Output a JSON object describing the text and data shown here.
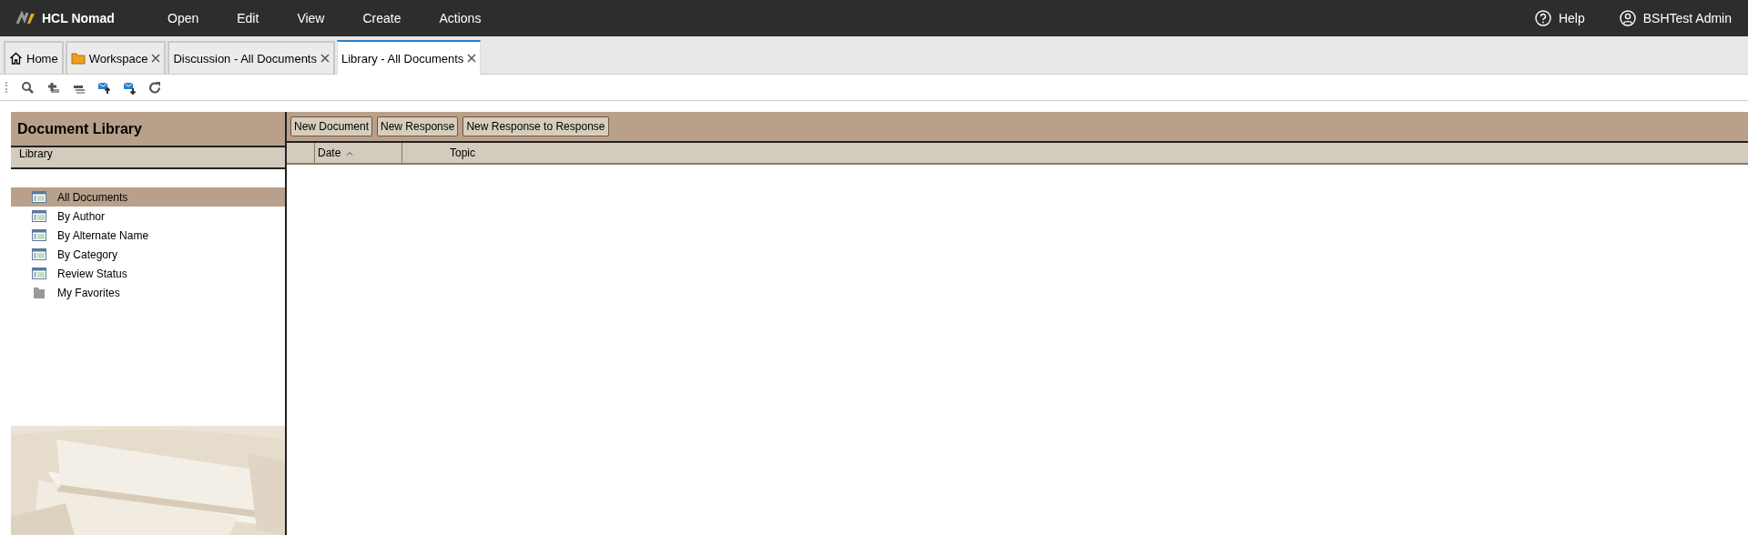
{
  "app": {
    "name": "HCL Nomad"
  },
  "menu": [
    "Open",
    "Edit",
    "View",
    "Create",
    "Actions"
  ],
  "header_links": [
    {
      "kind": "help",
      "label": "Help"
    },
    {
      "kind": "user",
      "label": "BSHTest Admin"
    }
  ],
  "tabs": [
    {
      "label": "Home",
      "kind": "home",
      "closable": false,
      "selected": false
    },
    {
      "label": "Workspace",
      "kind": "folder",
      "closable": true,
      "selected": false
    },
    {
      "label": "Discussion - All Documents",
      "kind": "plain",
      "closable": true,
      "selected": false
    },
    {
      "label": "Library - All Documents",
      "kind": "plain",
      "closable": true,
      "selected": true
    }
  ],
  "toolbar": [
    {
      "kind": "search"
    },
    {
      "kind": "add"
    },
    {
      "kind": "remove"
    },
    {
      "kind": "mail-up"
    },
    {
      "kind": "mail-down"
    },
    {
      "kind": "refresh"
    }
  ],
  "sidebar": {
    "title": "Document Library",
    "section": "Library",
    "items": [
      {
        "label": "All Documents",
        "kind": "view",
        "selected": true
      },
      {
        "label": "By Author",
        "kind": "view",
        "selected": false
      },
      {
        "label": "By Alternate Name",
        "kind": "view",
        "selected": false
      },
      {
        "label": "By Category",
        "kind": "view",
        "selected": false
      },
      {
        "label": "Review Status",
        "kind": "view",
        "selected": false
      },
      {
        "label": "My Favorites",
        "kind": "folder",
        "selected": false
      }
    ]
  },
  "actions": [
    "New Document",
    "New Response",
    "New Response to Response"
  ],
  "table": {
    "columns": [
      {
        "label": "Date",
        "sorted": true
      },
      {
        "label": "Topic",
        "sorted": false
      }
    ]
  }
}
